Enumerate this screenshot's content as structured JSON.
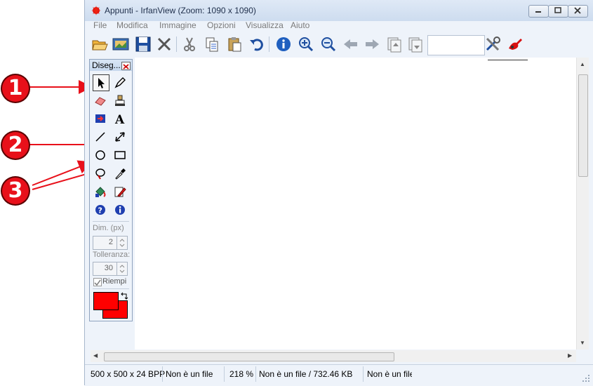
{
  "window": {
    "title": "Appunti - IrfanView (Zoom: 1090 x 1090)",
    "icon": "irfanview-icon"
  },
  "menu": [
    {
      "label": "File",
      "key": "F"
    },
    {
      "label": "Modifica",
      "key": "M"
    },
    {
      "label": "Immagine",
      "key": "I"
    },
    {
      "label": "Opzioni",
      "key": "O"
    },
    {
      "label": "Visualizza",
      "key": "V"
    },
    {
      "label": "Aiuto",
      "key": "A"
    }
  ],
  "toolbar": {
    "icons": [
      "open-folder-icon",
      "slideshow-icon",
      "save-icon",
      "delete-icon",
      "cut-icon",
      "copy-icon",
      "paste-icon",
      "undo-icon",
      "info-icon",
      "zoom-in-icon",
      "zoom-out-icon",
      "previous-icon",
      "next-icon",
      "first-page-icon",
      "last-page-icon",
      "settings-icon",
      "paint-icon"
    ],
    "page_input": ""
  },
  "palette": {
    "title": "Diseg...",
    "tools": [
      "selection-arrow-icon",
      "pencil-brush-icon",
      "eraser-icon",
      "stamp-icon",
      "shape-icon",
      "text-icon",
      "line-icon",
      "double-arrow-icon",
      "circle-icon",
      "rectangle-icon",
      "lasso-icon",
      "color-picker-icon",
      "fill-icon",
      "magic-brush-icon",
      "help-icon",
      "about-icon"
    ],
    "dim_label": "Dim. (px)",
    "dim_value": "2",
    "tolerance_label": "Tolleranza:",
    "tolerance_value": "30",
    "fill_label": "Riempi",
    "fill_checked": true,
    "foreground_color": "#ff0000",
    "background_color": "#ff0000"
  },
  "annotations": [
    {
      "label": "1"
    },
    {
      "label": "2"
    },
    {
      "label": "3"
    }
  ],
  "status": {
    "dimensions": "500 x 500 x 24 BPP",
    "file_state": "Non è un file",
    "zoom": "218 %",
    "file_size": "Non è un file / 732.46 KB",
    "extra": "Non è un file"
  },
  "colors": {
    "annotation_red": "#e8101a",
    "titlebar": "#dfe9f6"
  }
}
